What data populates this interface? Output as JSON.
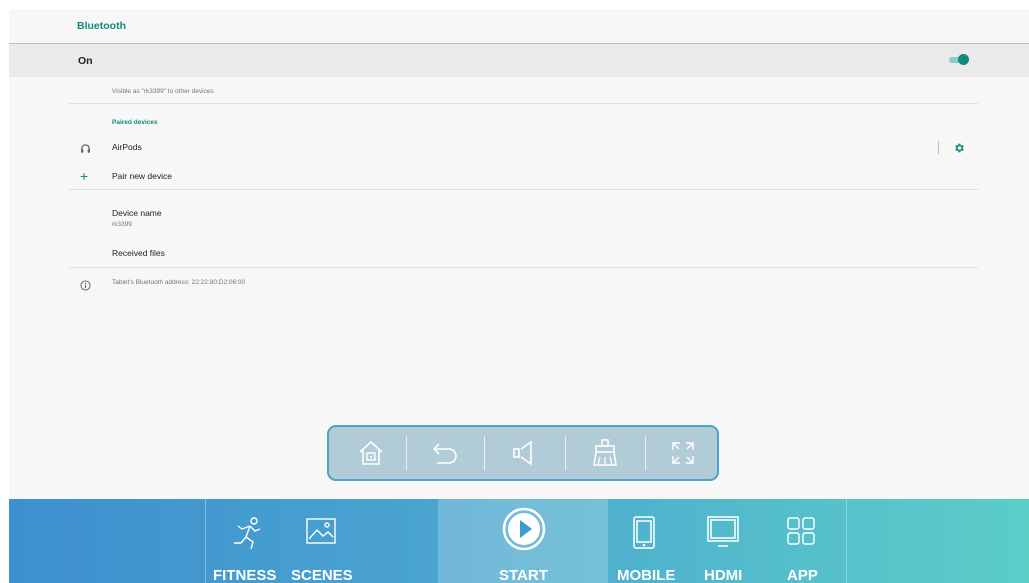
{
  "header": {
    "title": "Bluetooth"
  },
  "toggle_row": {
    "label": "On",
    "state": "on"
  },
  "visibility_text": "Visible as \"rk3399\" to other devices",
  "paired": {
    "section_title": "Paired devices",
    "devices": [
      {
        "name": "AirPods",
        "icon": "headphones-icon"
      }
    ]
  },
  "pair_new": {
    "label": "Pair new device",
    "icon": "plus-icon"
  },
  "device_name": {
    "label": "Device name",
    "value": "rk3399"
  },
  "received_files": {
    "label": "Received files"
  },
  "address_info": {
    "text": "Tablet's Bluetooth address: 22:22:80:D2:06:00",
    "icon": "info-icon"
  },
  "floating_nav": {
    "buttons": [
      "home-icon",
      "back-icon",
      "volume-icon",
      "clean-icon",
      "fullscreen-icon"
    ]
  },
  "dock": {
    "items": [
      {
        "label": "FITNESS",
        "icon": "runner-icon"
      },
      {
        "label": "SCENES",
        "icon": "picture-icon"
      },
      {
        "label": "START",
        "icon": "play-icon"
      },
      {
        "label": "MOBILE",
        "icon": "phone-icon"
      },
      {
        "label": "HDMI",
        "icon": "monitor-icon"
      },
      {
        "label": "APP",
        "icon": "grid-icon"
      }
    ]
  },
  "colors": {
    "accent": "#128a7c",
    "dock_start": "#3d8fcf",
    "dock_end": "#5bcec8"
  }
}
